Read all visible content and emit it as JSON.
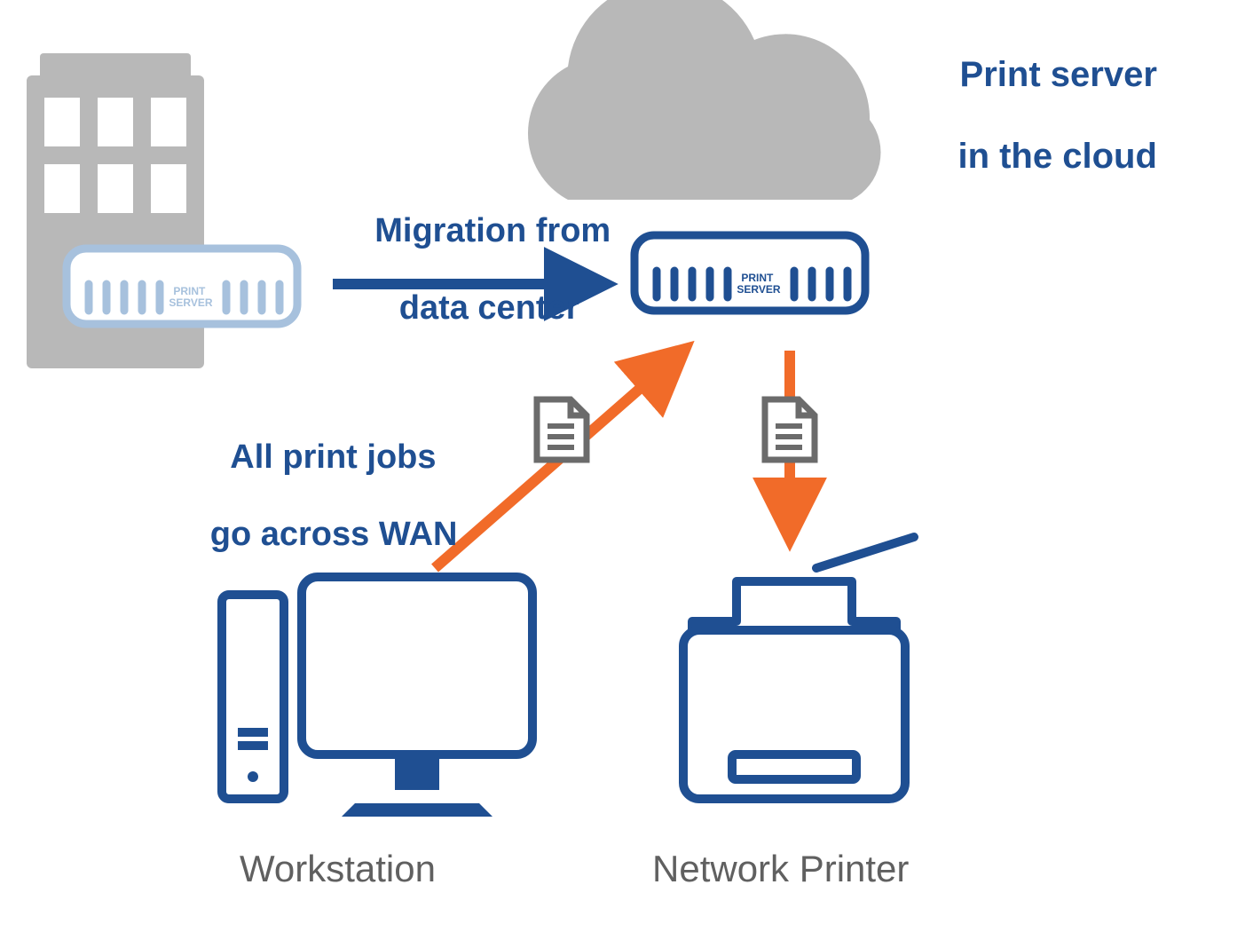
{
  "title_cloud_line1": "Print server",
  "title_cloud_line2": "in the cloud",
  "migration_line1": "Migration from",
  "migration_line2": "data center",
  "wan_line1": "All print jobs",
  "wan_line2": "go across WAN",
  "workstation_label": "Workstation",
  "printer_label": "Network Printer",
  "server_badge": "PRINT\nSERVER",
  "colors": {
    "blue": "#1f4f92",
    "blue_faded": "#a7c1dd",
    "orange": "#f16b29",
    "gray_icon": "#6b6b6b",
    "gray_shape": "#b8b8b8",
    "gray_text": "#606060"
  },
  "nodes": [
    {
      "id": "datacenter-building",
      "role": "origin datacenter"
    },
    {
      "id": "print-server-old",
      "role": "on-prem print server (faded)"
    },
    {
      "id": "cloud",
      "role": "cloud"
    },
    {
      "id": "print-server-cloud",
      "role": "cloud print server"
    },
    {
      "id": "workstation",
      "role": "client workstation"
    },
    {
      "id": "network-printer",
      "role": "network printer"
    }
  ],
  "edges": [
    {
      "from": "print-server-old",
      "to": "print-server-cloud",
      "label_ref": "migration",
      "color": "blue",
      "payload": null
    },
    {
      "from": "workstation",
      "to": "print-server-cloud",
      "label_ref": "wan",
      "color": "orange",
      "payload": "document"
    },
    {
      "from": "print-server-cloud",
      "to": "network-printer",
      "label_ref": null,
      "color": "orange",
      "payload": "document"
    }
  ]
}
